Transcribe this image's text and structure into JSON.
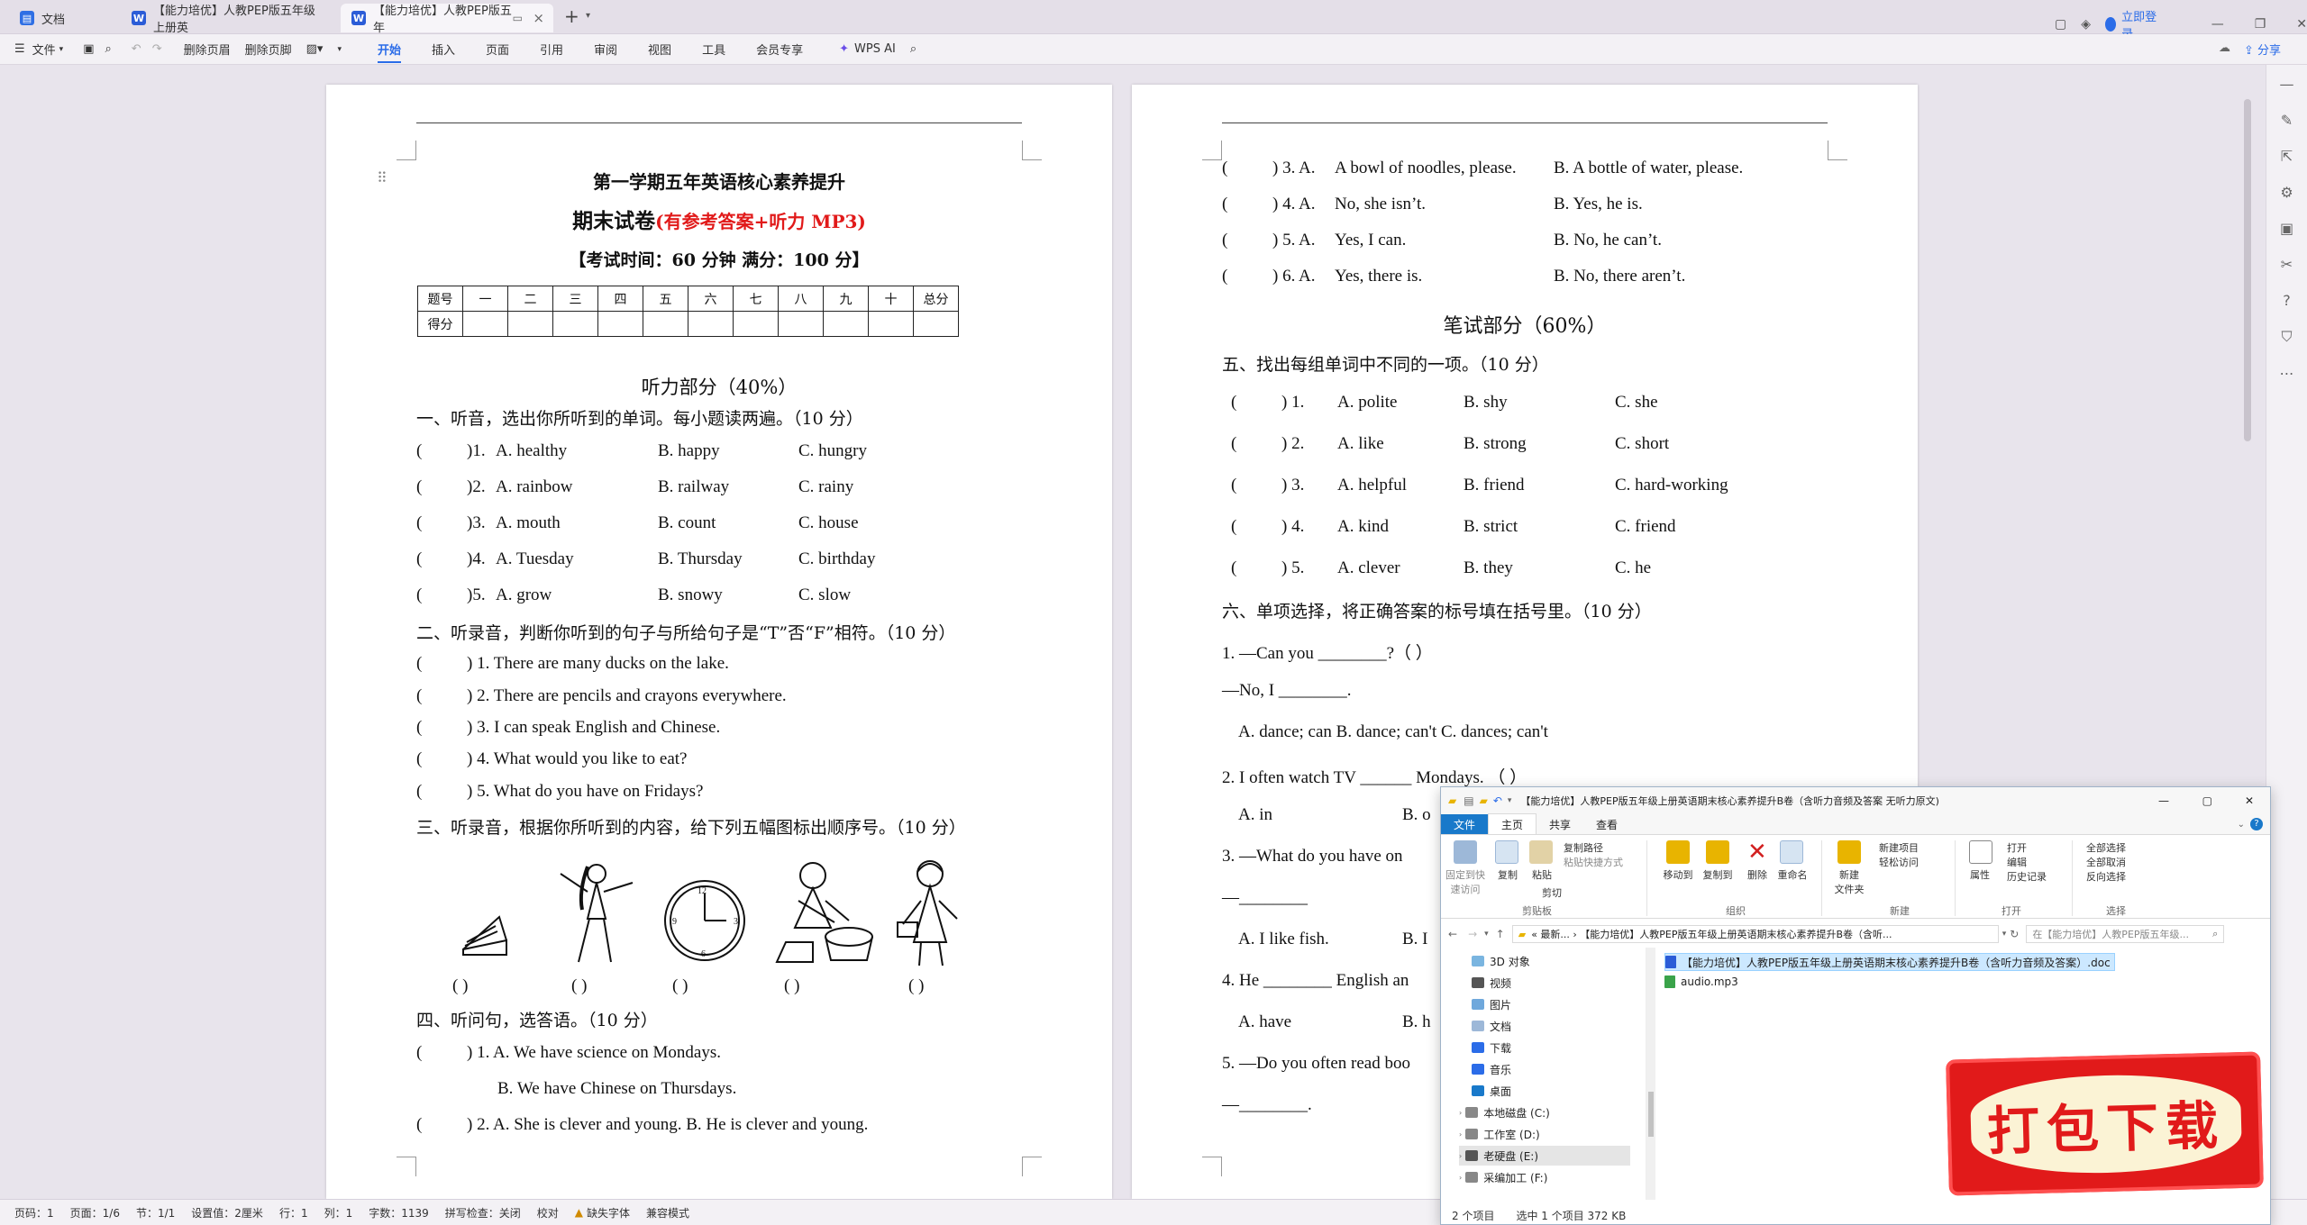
{
  "tabs": [
    {
      "label": "文档",
      "icon": "docs-icon"
    },
    {
      "label": "【能力培优】人教PEP版五年级上册英",
      "icon": "word-doc-icon"
    },
    {
      "label": "【能力培优】人教PEP版五年",
      "icon": "word-doc-icon"
    }
  ],
  "titlebar": {
    "login": "立即登录"
  },
  "menu": {
    "file": "文件",
    "del_header": "删除页眉",
    "del_footer": "删除页脚",
    "items": [
      "开始",
      "插入",
      "页面",
      "引用",
      "审阅",
      "视图",
      "工具",
      "会员专享"
    ],
    "wps_ai": "WPS AI",
    "share": "分享"
  },
  "page1": {
    "title": "第一学期五年英语核心素养提升",
    "subtitle_main": "期末试卷",
    "subtitle_red": "(有参考答案+听力 MP3)",
    "exam_info": "【考试时间：60 分钟  满分：100 分】",
    "score_headers": [
      "题号",
      "一",
      "二",
      "三",
      "四",
      "五",
      "六",
      "七",
      "八",
      "九",
      "十",
      "总分"
    ],
    "score_row_label": "得分",
    "listening_title": "听力部分（40%）",
    "sec1": "一、听音，选出你所听到的单词。每小题读两遍。（10 分）",
    "sec1_items": [
      {
        "num": ")1.",
        "a": "A.   healthy",
        "b": "B.   happy",
        "c": "C.   hungry"
      },
      {
        "num": ")2.",
        "a": "A.   rainbow",
        "b": "B.   railway",
        "c": "C.   rainy"
      },
      {
        "num": ")3.",
        "a": "A.   mouth",
        "b": "B.   count",
        "c": "C.   house"
      },
      {
        "num": ")4.",
        "a": "A.   Tuesday",
        "b": "B.   Thursday",
        "c": "C.   birthday"
      },
      {
        "num": ")5.",
        "a": "A.   grow",
        "b": "B.   snowy",
        "c": "C.   slow"
      }
    ],
    "sec2": "二、听录音，判断你听到的句子与所给句子是“T”否“F”相符。（10 分）",
    "sec2_items": [
      ") 1. There are many ducks on the lake.",
      ") 2. There are pencils and crayons everywhere.",
      ") 3. I can speak English and Chinese.",
      ") 4. What would you like to eat?",
      ") 5. What do you have on Fridays?"
    ],
    "sec3": "三、听录音，根据你所听到的内容，给下列五幅图标出顺序号。（10 分）",
    "sec4": "四、听问句，选答语。（10 分）",
    "sec4_items": [
      ") 1. A.   We have science on Mondays.",
      "B.   We have Chinese on Thursdays.",
      ") 2. A.   She is clever and young.        B.   He is clever and young."
    ]
  },
  "page2": {
    "top_items": [
      {
        "num": ") 3. A.",
        "a": "A bowl of noodles, please.",
        "b": "B.   A bottle of water, please."
      },
      {
        "num": ") 4. A.",
        "a": "No, she isn’t.",
        "b": "B.   Yes, he is."
      },
      {
        "num": ") 5. A.",
        "a": "Yes, I can.",
        "b": "B.   No, he can’t."
      },
      {
        "num": ") 6. A.",
        "a": "Yes, there is.",
        "b": "B.   No, there aren’t."
      }
    ],
    "written_title": "笔试部分（60%）",
    "sec5": "五、找出每组单词中不同的一项。（10 分）",
    "sec5_items": [
      {
        "num": ")   1.",
        "a": "A.   polite",
        "b": "B.   shy",
        "c": "C.   she"
      },
      {
        "num": ")   2.",
        "a": "A.   like",
        "b": "B.   strong",
        "c": "C.   short"
      },
      {
        "num": ")   3.",
        "a": "A.   helpful",
        "b": "B.   friend",
        "c": "C.   hard-working"
      },
      {
        "num": ")   4.",
        "a": "A.   kind",
        "b": "B.   strict",
        "c": "C.   friend"
      },
      {
        "num": ")   5.",
        "a": "A.   clever",
        "b": "B.   they",
        "c": "C.   he"
      }
    ],
    "sec6": "六、单项选择，将正确答案的标号填在括号里。（10 分）",
    "q1": "1.    —Can you ________?（          ）",
    "q1b": "—No, I ________.",
    "q1c": "A.   dance; can            B.   dance; can't               C.   dances; can't",
    "q2": "2.    I often watch TV ______ Mondays.  （          ）",
    "q2a": "A.   in",
    "q2b": "B.   o",
    "q3": "3.    —What do you have on",
    "q3b": "—________",
    "q3c": "A.   I like fish.",
    "q3d": "B.   I",
    "q4": "4.    He ________ English an",
    "q4a": "A.   have",
    "q4b": "B.   h",
    "q5": "5.    —Do you often read boo",
    "q5b": "—________."
  },
  "explorer": {
    "title": "【能力培优】人教PEP版五年级上册英语期末核心素养提升B卷（含听力音频及答案 无听力原文)",
    "tabs": [
      "文件",
      "主页",
      "共享",
      "查看"
    ],
    "ribbon": {
      "pin": "固定到快\n速访问",
      "copy": "复制",
      "paste": "粘贴",
      "copy_path": "复制路径",
      "paste_shortcut": "粘贴快捷方式",
      "cut": "剪切",
      "move_to": "移动到",
      "copy_to": "复制到",
      "delete": "删除",
      "rename": "重命名",
      "new_folder": "新建\n文件夹",
      "new_item": "新建项目",
      "easy_access": "轻松访问",
      "properties": "属性",
      "open": "打开",
      "edit": "编辑",
      "history": "历史记录",
      "select_all": "全部选择",
      "select_none": "全部取消",
      "invert": "反向选择",
      "groups": [
        "剪贴板",
        "组织",
        "新建",
        "打开",
        "选择"
      ]
    },
    "address": "« 最新...  ›  【能力培优】人教PEP版五年级上册英语期末核心素养提升B卷（含听...",
    "search": "在【能力培优】人教PEP版五年级...",
    "nav": [
      "3D 对象",
      "视频",
      "图片",
      "文档",
      "下载",
      "音乐",
      "桌面",
      "本地磁盘 (C:)",
      "工作室 (D:)",
      "老硬盘 (E:)",
      "采编加工 (F:)"
    ],
    "files": [
      "【能力培优】人教PEP版五年级上册英语期末核心素养提升B卷（含听力音频及答案）.doc",
      "audio.mp3"
    ],
    "status_count": "2 个项目",
    "status_sel": "选中 1 个项目  372 KB"
  },
  "statusbar": {
    "items": [
      "页码：1",
      "页面：1/6",
      "节：1/1",
      "设置值：2厘米",
      "行：1",
      "列：1",
      "字数：1139",
      "拼写检查：关闭",
      "校对",
      "缺失字体",
      "兼容模式"
    ],
    "zoom_icons": ""
  },
  "stamp": {
    "text": "打包下载"
  },
  "colors": {
    "accent": "#2b6ce8",
    "red_title": "#e11a1a",
    "explorer_blue": "#1979ca"
  }
}
